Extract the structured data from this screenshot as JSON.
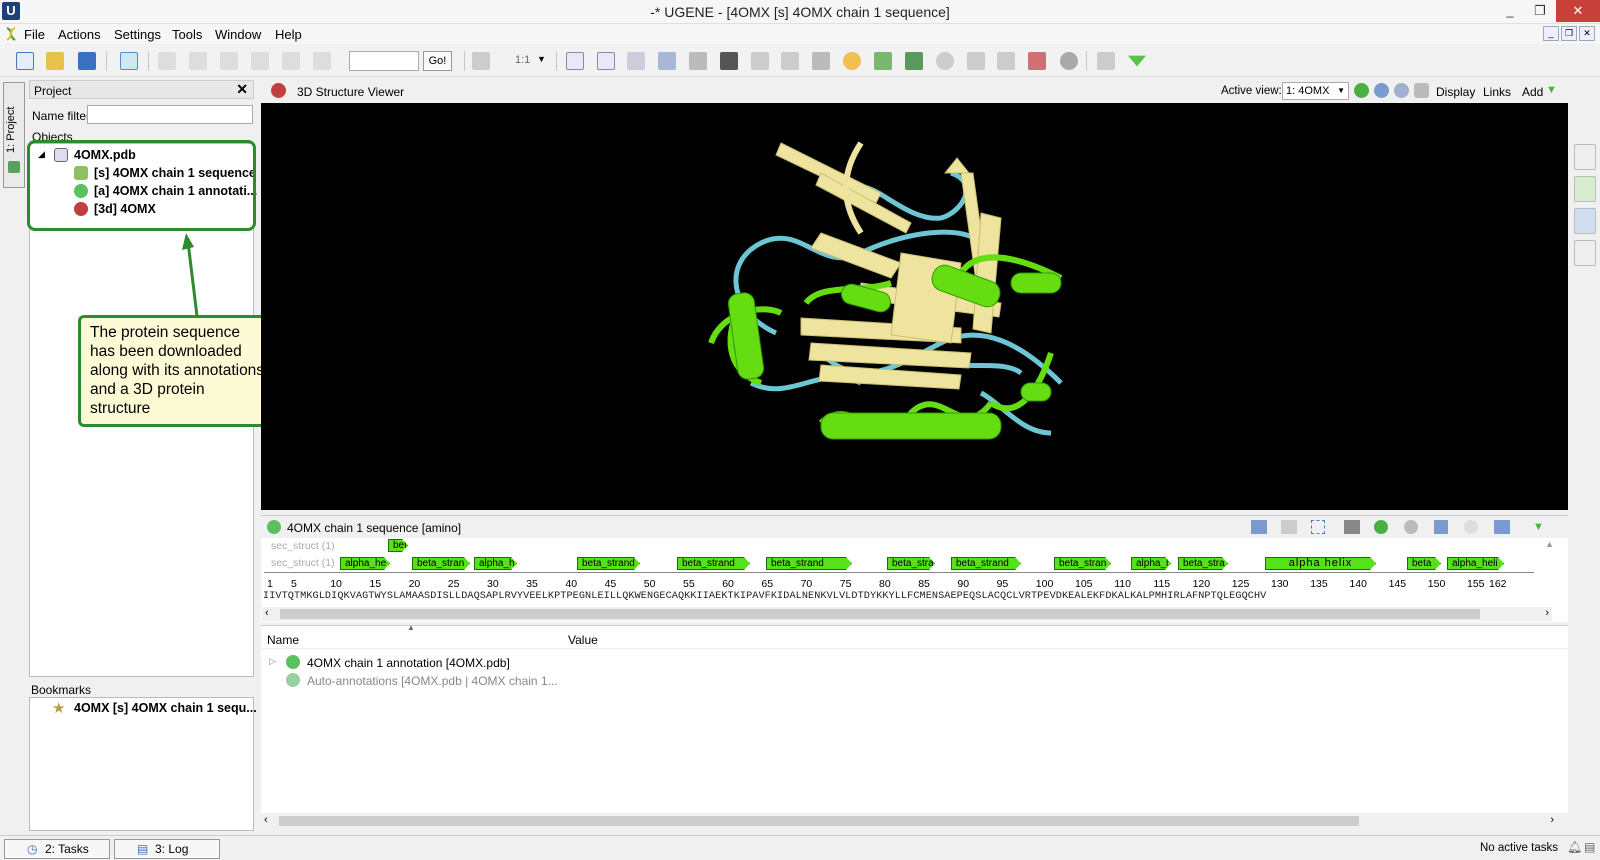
{
  "window": {
    "title": "-* UGENE - [4OMX [s] 4OMX chain 1 sequence]",
    "logo_letter": "U",
    "min_glyph": "_",
    "max_glyph": "❐",
    "close_glyph": "✕"
  },
  "menu": [
    "File",
    "Actions",
    "Settings",
    "Tools",
    "Window",
    "Help"
  ],
  "toolbar": {
    "go_label": "Go!",
    "zoom_label": "1:1"
  },
  "side_tab": {
    "label": "1: Project"
  },
  "project": {
    "header": "Project",
    "close_glyph": "✕",
    "name_filter_label": "Name filter",
    "objects_label": "Objects",
    "items": [
      {
        "label": "4OMX.pdb",
        "icon": "document-icon"
      },
      {
        "label": "[s] 4OMX chain 1 sequence",
        "icon": "sequence-icon"
      },
      {
        "label": "[a] 4OMX chain 1 annotati...",
        "icon": "annotation-icon"
      },
      {
        "label": "[3d] 4OMX",
        "icon": "molecule-icon"
      }
    ]
  },
  "callout": {
    "text": "The protein sequence has been downloaded along with its annotations and a 3D protein structure"
  },
  "bookmarks": {
    "label": "Bookmarks",
    "items": [
      {
        "label": "4OMX [s] 4OMX chain 1 sequ..."
      }
    ]
  },
  "viewer": {
    "title": "3D Structure Viewer",
    "active_view_label": "Active view:",
    "active_view_value": "1: 4OMX",
    "links": [
      "Display",
      "Links",
      "Add"
    ],
    "colors": {
      "helix": "#66dd11",
      "strand": "#eee4a0",
      "coil": "#6cc6d4"
    }
  },
  "sequence": {
    "title": "4OMX chain 1 sequence [amino]",
    "track_labels": [
      "sec_struct (1)",
      "sec_struct (1)"
    ],
    "top_annotations": [
      {
        "label": "bet"
      }
    ],
    "annotations": [
      {
        "label": "alpha_he"
      },
      {
        "label": "beta_stran"
      },
      {
        "label": "alpha_h"
      },
      {
        "label": "beta_strand"
      },
      {
        "label": "beta_strand"
      },
      {
        "label": "beta_strand"
      },
      {
        "label": "beta_stra"
      },
      {
        "label": "beta_strand"
      },
      {
        "label": "beta_stran"
      },
      {
        "label": "alpha_h"
      },
      {
        "label": "beta_stra"
      },
      {
        "label": "alpha helix"
      },
      {
        "label": "beta"
      },
      {
        "label": "alpha_heli"
      }
    ],
    "ruler": [
      "1",
      "5",
      "10",
      "15",
      "20",
      "25",
      "30",
      "35",
      "40",
      "45",
      "50",
      "55",
      "60",
      "65",
      "70",
      "75",
      "80",
      "85",
      "90",
      "95",
      "100",
      "105",
      "110",
      "115",
      "120",
      "125",
      "130",
      "135",
      "140",
      "145",
      "150",
      "155",
      "162"
    ],
    "residues": "IIVTQTMKGLDIQKVAGTWYSLAMAASDISLLDAQSAPLRVYVEELKPTPEGNLEILLQKWENGECAQKKIIAEKTKIPAVFKIDALNENKVLVLDTDYKKYLLFCMENSAEPEQSLACQCLVRTPEVDKEALEKFDKALKALPMHIRLAFNPTQLEGQCHV"
  },
  "annotations_table": {
    "columns": [
      "Name",
      "Value"
    ],
    "rows": [
      {
        "label": "4OMX chain 1 annotation [4OMX.pdb]",
        "expandable": true
      },
      {
        "label": "Auto-annotations [4OMX.pdb | 4OMX chain 1...",
        "expandable": false
      }
    ]
  },
  "status": {
    "tabs": [
      {
        "label": "2: Tasks"
      },
      {
        "label": "3: Log"
      }
    ],
    "right_text": "No active tasks"
  }
}
